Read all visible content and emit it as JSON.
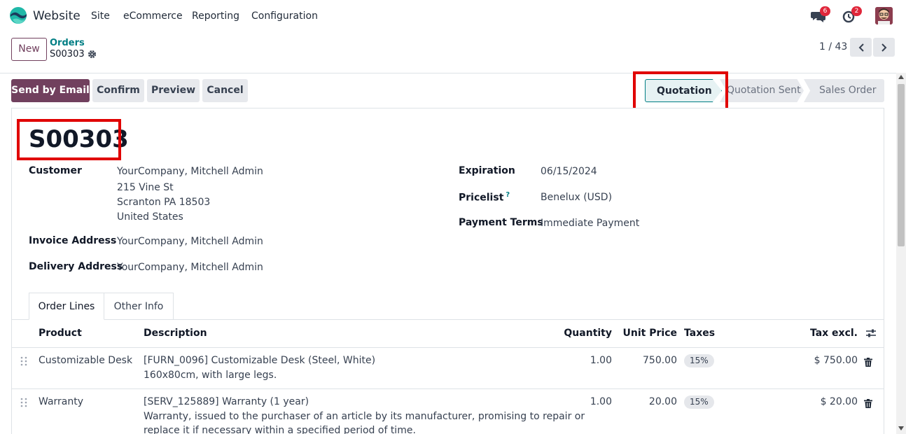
{
  "navbar": {
    "app_name": "Website",
    "menu": [
      "Site",
      "eCommerce",
      "Reporting",
      "Configuration"
    ],
    "messages_count": "6",
    "activities_count": "2"
  },
  "control_panel": {
    "new_label": "New",
    "breadcrumb_parent": "Orders",
    "breadcrumb_current": "S00303",
    "pager_value": "1 / 43"
  },
  "actions": {
    "send_email": "Send by Email",
    "confirm": "Confirm",
    "preview": "Preview",
    "cancel": "Cancel"
  },
  "statusbar": {
    "stages": [
      "Quotation",
      "Quotation Sent",
      "Sales Order"
    ],
    "active": "Quotation"
  },
  "form": {
    "order_name": "S00303",
    "customer_label": "Customer",
    "customer_name": "YourCompany, Mitchell Admin",
    "customer_street": "215 Vine St",
    "customer_city": "Scranton PA 18503",
    "customer_country": "United States",
    "invoice_label": "Invoice Address",
    "invoice_value": "YourCompany, Mitchell Admin",
    "delivery_label": "Delivery Address",
    "delivery_value": "YourCompany, Mitchell Admin",
    "expiration_label": "Expiration",
    "expiration_value": "06/15/2024",
    "pricelist_label": "Pricelist",
    "pricelist_help": "?",
    "pricelist_value": "Benelux (USD)",
    "payment_terms_label": "Payment Terms",
    "payment_terms_value": "Immediate Payment"
  },
  "tabs": [
    "Order Lines",
    "Other Info"
  ],
  "order_lines": {
    "columns": [
      "Product",
      "Description",
      "Quantity",
      "Unit Price",
      "Taxes",
      "Tax excl."
    ],
    "rows": [
      {
        "product": "Customizable Desk",
        "desc_line1": "[FURN_0096] Customizable Desk (Steel, White)",
        "desc_line2": "160x80cm, with large legs.",
        "desc_line3": "",
        "quantity": "1.00",
        "unit_price": "750.00",
        "tax": "15%",
        "subtotal": "$ 750.00"
      },
      {
        "product": "Warranty",
        "desc_line1": "[SERV_125889] Warranty (1 year)",
        "desc_line2": "Warranty, issued to the purchaser of an article by its manufacturer, promising to repair or",
        "desc_line3": "replace it if necessary within a specified period of time.",
        "quantity": "1.00",
        "unit_price": "20.00",
        "tax": "15%",
        "subtotal": "$ 20.00"
      }
    ]
  },
  "colors": {
    "primary": "#71405e",
    "accent": "#017e84",
    "highlight": "#e00000"
  }
}
